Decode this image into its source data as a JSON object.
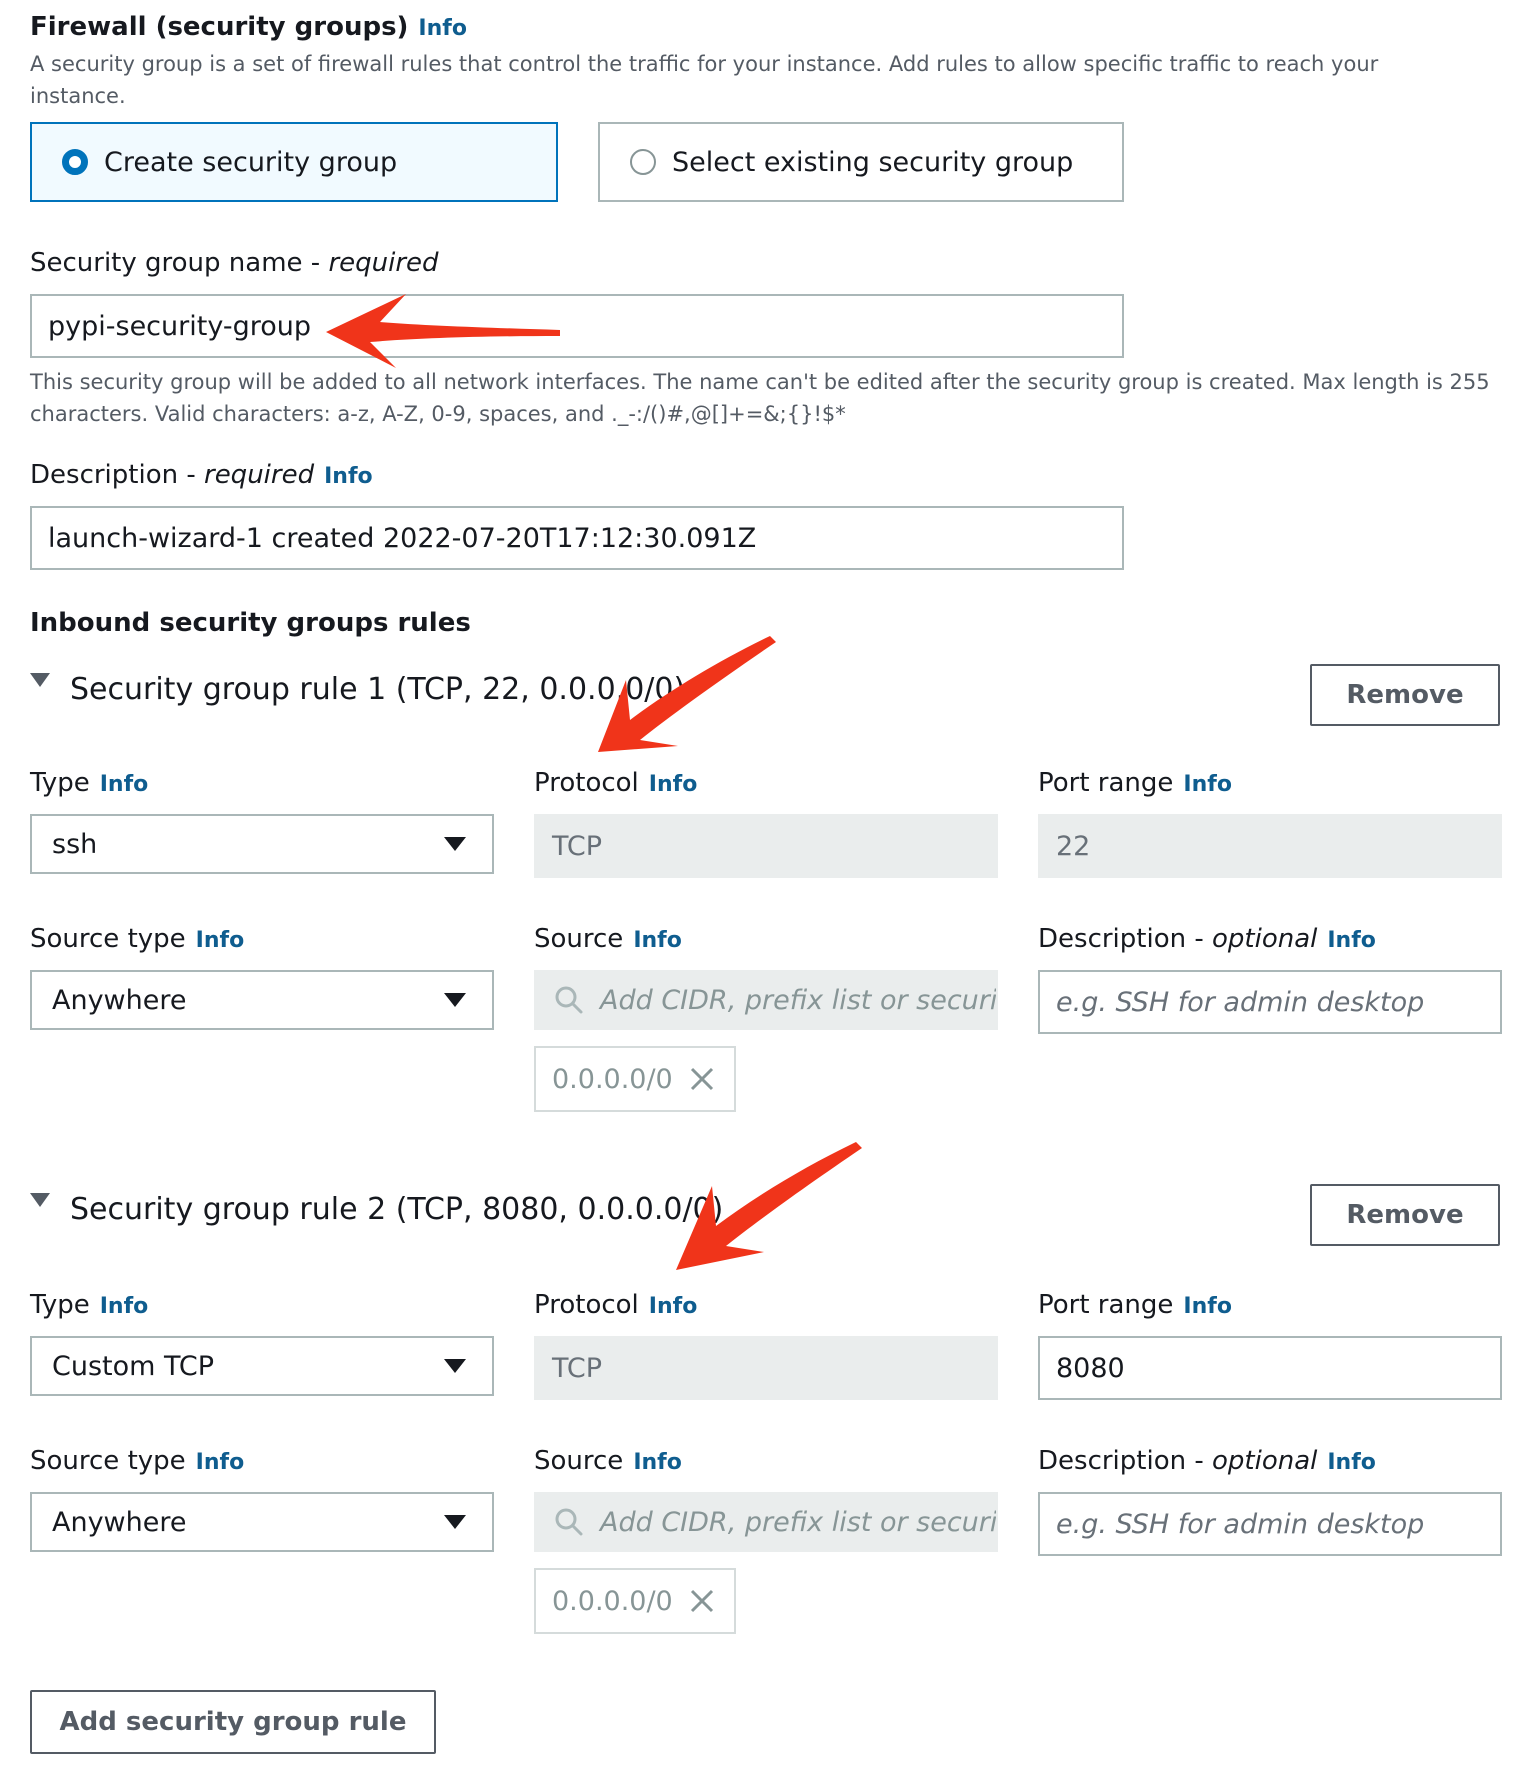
{
  "firewall": {
    "title": "Firewall (security groups)",
    "info": "Info",
    "description": "A security group is a set of firewall rules that control the traffic for your instance. Add rules to allow specific traffic to reach your instance.",
    "options": [
      {
        "label": "Create security group",
        "selected": true
      },
      {
        "label": "Select existing security group",
        "selected": false
      }
    ]
  },
  "sg_name": {
    "label": "Security group name - ",
    "required": "required",
    "value": "pypi-security-group",
    "help": "This security group will be added to all network interfaces. The name can't be edited after the security group is created. Max length is 255 characters. Valid characters: a-z, A-Z, 0-9, spaces, and ._-:/()#,@[]+=&;{}!$*"
  },
  "sg_description": {
    "label": "Description - ",
    "required": "required",
    "info": "Info",
    "value": "launch-wizard-1 created 2022-07-20T17:12:30.091Z"
  },
  "inbound": {
    "title": "Inbound security groups rules",
    "rules": [
      {
        "title": "Security group rule 1 (TCP, 22, 0.0.0.0/0)",
        "remove": "Remove",
        "type_label": "Type",
        "type_value": "ssh",
        "protocol_label": "Protocol",
        "protocol_value": "TCP",
        "port_label": "Port range",
        "port_value": "22",
        "source_type_label": "Source type",
        "source_type_value": "Anywhere",
        "source_label": "Source",
        "source_placeholder": "Add CIDR, prefix list or security",
        "source_token": "0.0.0.0/0",
        "desc_label": "Description - ",
        "desc_optional": "optional",
        "desc_placeholder": "e.g. SSH for admin desktop",
        "info": "Info"
      },
      {
        "title": "Security group rule 2 (TCP, 8080, 0.0.0.0/0)",
        "remove": "Remove",
        "type_label": "Type",
        "type_value": "Custom TCP",
        "protocol_label": "Protocol",
        "protocol_value": "TCP",
        "port_label": "Port range",
        "port_value": "8080",
        "source_type_label": "Source type",
        "source_type_value": "Anywhere",
        "source_label": "Source",
        "source_placeholder": "Add CIDR, prefix list or security",
        "source_token": "0.0.0.0/0",
        "desc_label": "Description - ",
        "desc_optional": "optional",
        "desc_placeholder": "e.g. SSH for admin desktop",
        "info": "Info"
      }
    ],
    "add_rule": "Add security group rule"
  },
  "colors": {
    "link": "#0f5d8f",
    "selected_border": "#0073bb",
    "annotation_arrow": "#f0341a"
  }
}
